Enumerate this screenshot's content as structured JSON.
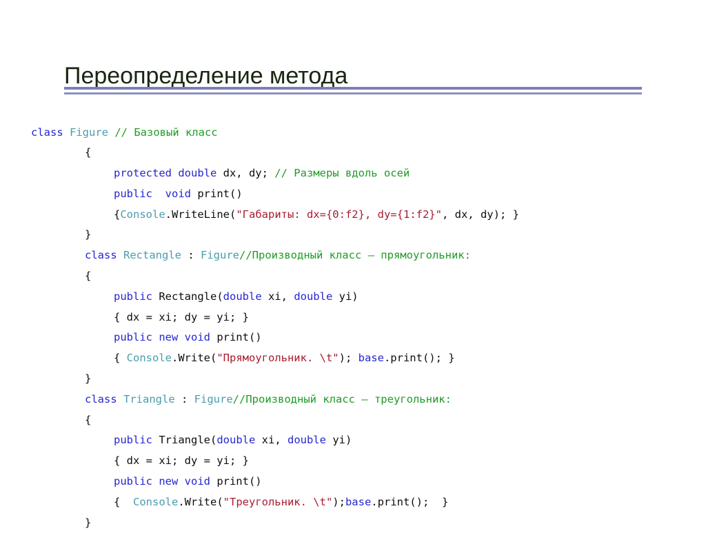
{
  "slide": {
    "title": "Переопределение метода",
    "accent_color": "#7d80b3",
    "background_color": "#ffffff"
  },
  "syntax_colors": {
    "keyword": "#2526cf",
    "type": "#4a9cab",
    "comment": "#1f9b26",
    "string": "#a81c2e",
    "plain": "#0d0d0d"
  },
  "code": {
    "language": "C#",
    "lines": [
      {
        "indent": 0,
        "tokens": [
          {
            "t": "class ",
            "c": "kw"
          },
          {
            "t": "Figure ",
            "c": "typ"
          },
          {
            "t": "// Базовый класс",
            "c": "cmt"
          }
        ]
      },
      {
        "indent": 1,
        "tokens": [
          {
            "t": "{",
            "c": "pln"
          }
        ]
      },
      {
        "indent": 2,
        "tokens": [
          {
            "t": "protected double ",
            "c": "kw"
          },
          {
            "t": "dx, dy; ",
            "c": "pln"
          },
          {
            "t": "// Размеры вдоль осей",
            "c": "cmt"
          }
        ]
      },
      {
        "indent": 2,
        "tokens": [
          {
            "t": "public  void ",
            "c": "kw"
          },
          {
            "t": "print()",
            "c": "pln"
          }
        ]
      },
      {
        "indent": 2,
        "tokens": [
          {
            "t": "{",
            "c": "pln"
          },
          {
            "t": "Console",
            "c": "typ"
          },
          {
            "t": ".WriteLine(",
            "c": "pln"
          },
          {
            "t": "\"Габариты: dx={0:f2}, dy={1:f2}\"",
            "c": "str"
          },
          {
            "t": ", dx, dy); }",
            "c": "pln"
          }
        ]
      },
      {
        "indent": 1,
        "tokens": [
          {
            "t": "}",
            "c": "pln"
          }
        ]
      },
      {
        "indent": 1,
        "tokens": [
          {
            "t": "class ",
            "c": "kw"
          },
          {
            "t": "Rectangle ",
            "c": "typ"
          },
          {
            "t": ": ",
            "c": "pln"
          },
          {
            "t": "Figure",
            "c": "typ"
          },
          {
            "t": "//Производный класс – прямоугольник:",
            "c": "cmt"
          }
        ]
      },
      {
        "indent": 1,
        "tokens": [
          {
            "t": "{",
            "c": "pln"
          }
        ]
      },
      {
        "indent": 2,
        "tokens": [
          {
            "t": "public ",
            "c": "kw"
          },
          {
            "t": "Rectangle(",
            "c": "pln"
          },
          {
            "t": "double ",
            "c": "kw"
          },
          {
            "t": "xi, ",
            "c": "pln"
          },
          {
            "t": "double ",
            "c": "kw"
          },
          {
            "t": "yi)",
            "c": "pln"
          }
        ]
      },
      {
        "indent": 2,
        "tokens": [
          {
            "t": "{ dx = xi; dy = yi; }",
            "c": "pln"
          }
        ]
      },
      {
        "indent": 2,
        "tokens": [
          {
            "t": "public new void ",
            "c": "kw"
          },
          {
            "t": "print()",
            "c": "pln"
          }
        ]
      },
      {
        "indent": 2,
        "tokens": [
          {
            "t": "{ ",
            "c": "pln"
          },
          {
            "t": "Console",
            "c": "typ"
          },
          {
            "t": ".Write(",
            "c": "pln"
          },
          {
            "t": "\"Прямоугольник. \\t\"",
            "c": "str"
          },
          {
            "t": "); ",
            "c": "pln"
          },
          {
            "t": "base",
            "c": "kw"
          },
          {
            "t": ".print(); }",
            "c": "pln"
          }
        ]
      },
      {
        "indent": 1,
        "tokens": [
          {
            "t": "}",
            "c": "pln"
          }
        ]
      },
      {
        "indent": 1,
        "tokens": [
          {
            "t": "class ",
            "c": "kw"
          },
          {
            "t": "Triangle ",
            "c": "typ"
          },
          {
            "t": ": ",
            "c": "pln"
          },
          {
            "t": "Figure",
            "c": "typ"
          },
          {
            "t": "//Производный класс – треугольник:",
            "c": "cmt"
          }
        ]
      },
      {
        "indent": 1,
        "tokens": [
          {
            "t": "{",
            "c": "pln"
          }
        ]
      },
      {
        "indent": 2,
        "tokens": [
          {
            "t": "public ",
            "c": "kw"
          },
          {
            "t": "Triangle(",
            "c": "pln"
          },
          {
            "t": "double ",
            "c": "kw"
          },
          {
            "t": "xi, ",
            "c": "pln"
          },
          {
            "t": "double ",
            "c": "kw"
          },
          {
            "t": "yi)",
            "c": "pln"
          }
        ]
      },
      {
        "indent": 2,
        "tokens": [
          {
            "t": "{ dx = xi; dy = yi; }",
            "c": "pln"
          }
        ]
      },
      {
        "indent": 2,
        "tokens": [
          {
            "t": "public new void ",
            "c": "kw"
          },
          {
            "t": "print()",
            "c": "pln"
          }
        ]
      },
      {
        "indent": 2,
        "tokens": [
          {
            "t": "{  ",
            "c": "pln"
          },
          {
            "t": "Console",
            "c": "typ"
          },
          {
            "t": ".Write(",
            "c": "pln"
          },
          {
            "t": "\"Треугольник. \\t\"",
            "c": "str"
          },
          {
            "t": ");",
            "c": "pln"
          },
          {
            "t": "base",
            "c": "kw"
          },
          {
            "t": ".print();  }",
            "c": "pln"
          }
        ]
      },
      {
        "indent": 1,
        "tokens": [
          {
            "t": "}",
            "c": "pln"
          }
        ]
      }
    ]
  }
}
